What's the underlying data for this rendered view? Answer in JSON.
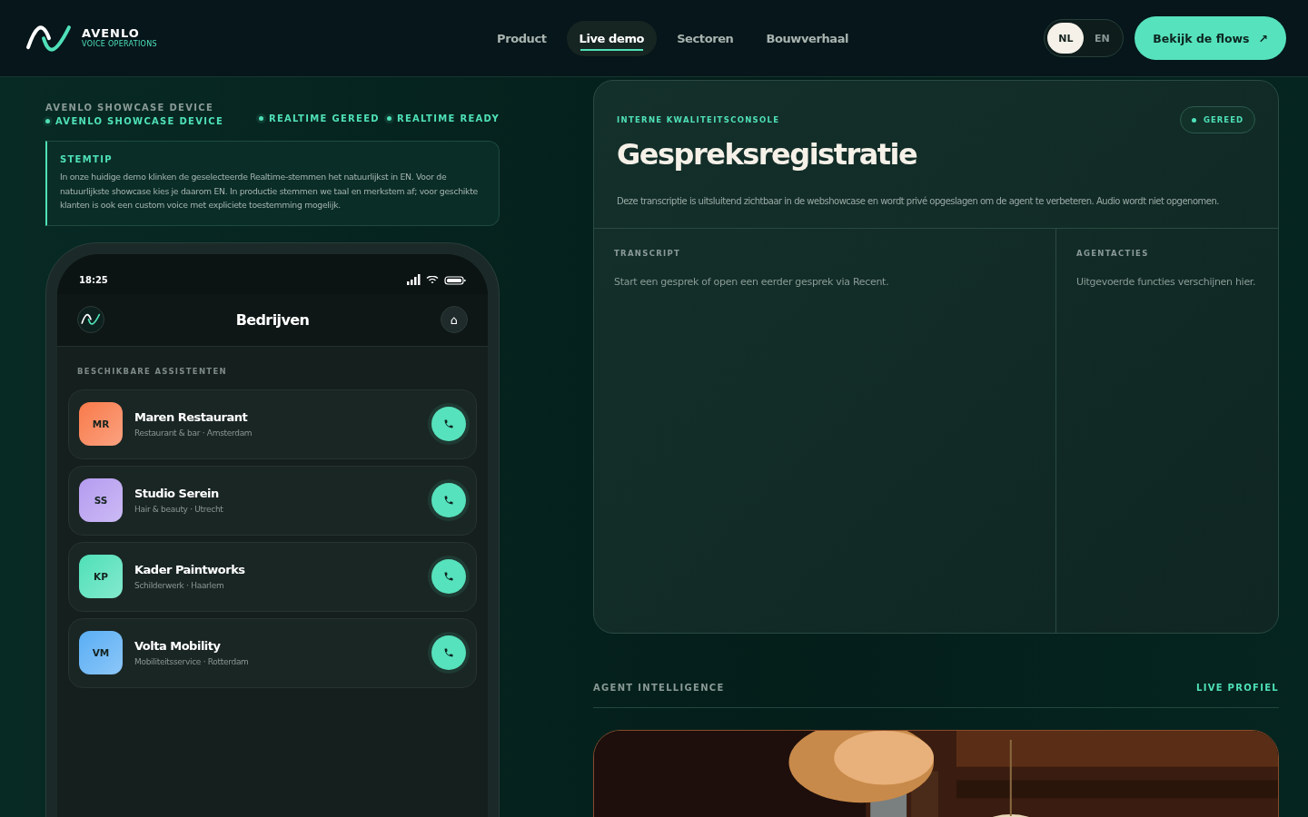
{
  "brand": {
    "name": "AVENLO",
    "tagline": "VOICE OPERATIONS"
  },
  "nav": [
    {
      "label": "Product",
      "selected": false
    },
    {
      "label": "Live demo",
      "selected": true
    },
    {
      "label": "Sectoren",
      "selected": false
    },
    {
      "label": "Bouwverhaal",
      "selected": false
    }
  ],
  "languages": [
    {
      "label": "NL",
      "selected": true
    },
    {
      "label": "EN",
      "selected": false
    }
  ],
  "cta": {
    "label": "Bekijk de flows",
    "icon": "↗"
  },
  "device_header": {
    "title": "AVENLO SHOWCASE DEVICE",
    "subtitle": "AVENLO SHOWCASE DEVICE",
    "statuses": [
      "REALTIME GEREED",
      "REALTIME READY"
    ]
  },
  "tip": {
    "title": "STEMTIP",
    "text": "In onze huidige demo klinken de geselecteerde Realtime-stemmen het natuurlijkst in EN. Voor de natuurlijkste showcase kies je daarom EN. In productie stemmen we taal en merkstem af; voor geschikte klanten is ook een custom voice met expliciete toestemming mogelijk."
  },
  "phone": {
    "time": "18:25",
    "title": "Bedrijven",
    "home_icon": "⌂",
    "section": "BESCHIKBARE ASSISTENTEN",
    "assistants": [
      {
        "initials": "MR",
        "name": "Maren Restaurant",
        "meta": "Restaurant & bar · Amsterdam",
        "color": "#f97a4a"
      },
      {
        "initials": "SS",
        "name": "Studio Serein",
        "meta": "Hair & beauty · Utrecht",
        "color": "#b59cf0"
      },
      {
        "initials": "KP",
        "name": "Kader Paintworks",
        "meta": "Schilderwerk · Haarlem",
        "color": "#4fe0b8"
      },
      {
        "initials": "VM",
        "name": "Volta Mobility",
        "meta": "Mobiliteitsservice · Rotterdam",
        "color": "#5aaef5"
      }
    ]
  },
  "console": {
    "eyebrow": "INTERNE KWALITEITSCONSOLE",
    "status": "GEREED",
    "title": "Gespreksregistratie",
    "description": "Deze transcriptie is uitsluitend zichtbaar in de webshowcase en wordt privé opgeslagen om de agent te verbeteren. Audio wordt niet opgenomen.",
    "columns": [
      {
        "heading": "TRANSCRIPT",
        "text": "Start een gesprek of open een eerder gesprek via Recent."
      },
      {
        "heading": "AGENTACTIES",
        "text": "Uitgevoerde functies verschijnen hier."
      }
    ]
  },
  "intelligence": {
    "title": "AGENT INTELLIGENCE",
    "link": "LIVE PROFIEL"
  }
}
